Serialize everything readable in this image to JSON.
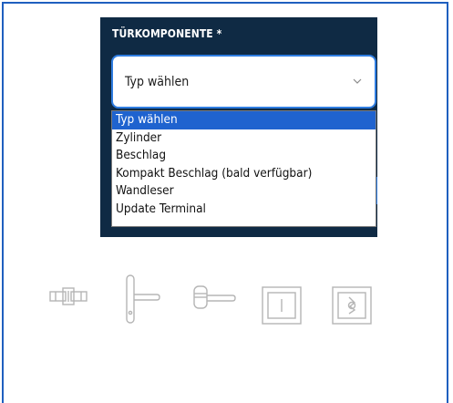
{
  "form": {
    "label": "TÜRKOMPONENTE *",
    "select_value": "Typ wählen",
    "options": [
      {
        "label": "Typ wählen",
        "selected": true
      },
      {
        "label": "Zylinder"
      },
      {
        "label": "Beschlag"
      },
      {
        "label": "Kompakt Beschlag (bald verfügbar)"
      },
      {
        "label": "Wandleser"
      },
      {
        "label": "Update Terminal"
      }
    ]
  },
  "icons": [
    "cylinder-icon",
    "handle-fitting-icon",
    "compact-handle-icon",
    "wall-reader-icon",
    "update-terminal-icon"
  ],
  "colors": {
    "panel": "#0f2a44",
    "accent": "#2f7de1",
    "selected_option": "#1f63cf",
    "border": "#1f5fbf",
    "icon_gray": "#b5b5b5"
  }
}
